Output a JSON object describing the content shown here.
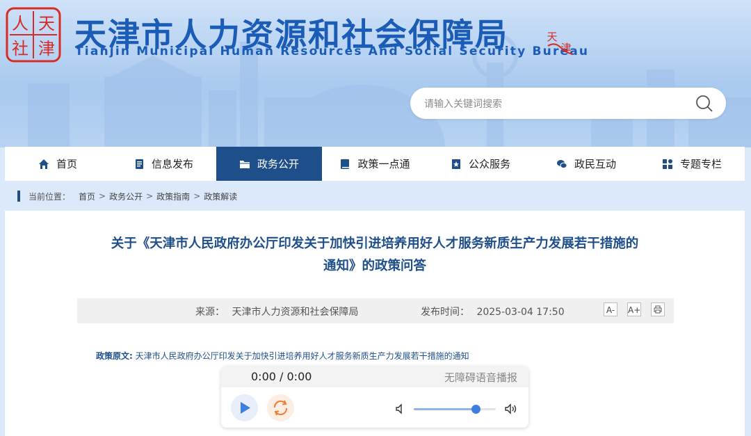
{
  "header": {
    "logo_chars": [
      "人",
      "天",
      "社",
      "津"
    ],
    "title_cn": "天津市人力资源和社会保障局",
    "title_en": "Tianjin Municipal Human Resources And Social Security Bureau",
    "seal_chars": [
      "天",
      "津"
    ]
  },
  "search": {
    "placeholder": "请输入关键词搜索",
    "value": ""
  },
  "nav": {
    "items": [
      {
        "label": "首页",
        "icon": "home-icon"
      },
      {
        "label": "信息发布",
        "icon": "document-icon"
      },
      {
        "label": "政务公开",
        "icon": "folder-icon",
        "active": true
      },
      {
        "label": "政策一点通",
        "icon": "book-icon"
      },
      {
        "label": "公众服务",
        "icon": "badge-icon"
      },
      {
        "label": "政民互动",
        "icon": "chat-icon"
      },
      {
        "label": "专题专栏",
        "icon": "grid-icon"
      }
    ]
  },
  "breadcrumb": {
    "prefix": "当前位置：",
    "items": [
      "首页",
      "政务公开",
      "政策指南",
      "政策解读"
    ],
    "separator": ">"
  },
  "article": {
    "title_line1": "关于《天津市人民政府办公厅印发关于加快引进培养用好人才服务新质生产力发展若干措施的",
    "title_line2": "通知》的政策问答",
    "source_label": "来源：",
    "source_value": "天津市人力资源和社会保障局",
    "time_label": "发布时间：",
    "time_value": "2025-03-04 17:50",
    "font_decrease": "A-",
    "font_increase": "A+",
    "print_icon": "print-icon",
    "policy_label": "政策原文:",
    "policy_link": "天津市人民政府办公厅印发关于加快引进培养用好人才服务新质生产力发展若干措施的通知"
  },
  "player": {
    "time": "0:00 / 0:00",
    "label": "无障碍语音播报",
    "volume": 0.75
  },
  "colors": {
    "brand": "#1b5cb7",
    "nav_active": "#1f4f8b",
    "slider": "#3f7fe0"
  }
}
